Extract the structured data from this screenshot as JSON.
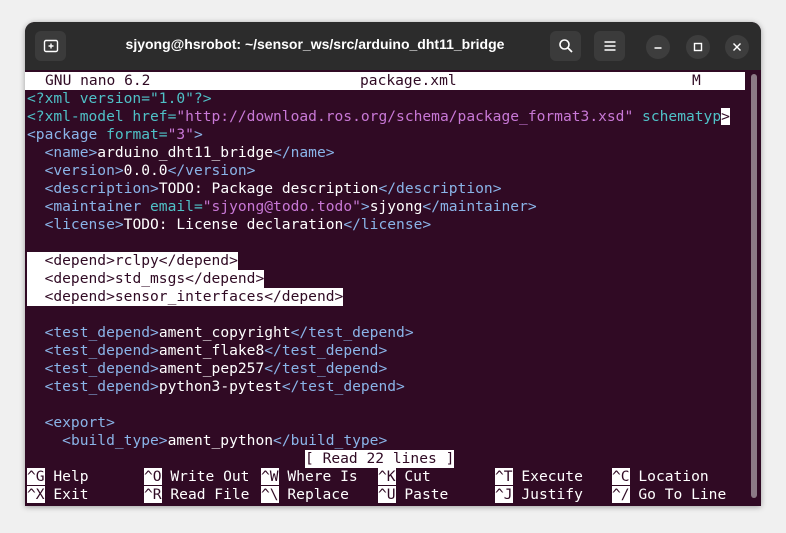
{
  "window": {
    "title": "sjyong@hsrobot: ~/sensor_ws/src/arduino_dht11_bridge"
  },
  "icons": {
    "new_tab": "new-tab-icon",
    "search": "search-icon",
    "menu": "hamburger-menu-icon",
    "minimize": "minimize-icon",
    "maximize": "maximize-icon",
    "close": "close-icon"
  },
  "nano": {
    "version": "GNU nano 6.2",
    "filename": "package.xml",
    "modified": "M",
    "status": "[ Read 22 lines ]"
  },
  "code": {
    "l1_pi": "<?xml version=\"1.0\"?>",
    "l2_pi": "<?xml-model href=",
    "l2_str": "\"http://download.ros.org/schema/package_format3.xsd\"",
    "l2_attr": " schematyp",
    "l2_cursor": ">",
    "l3_tag": "<package",
    "l3_attr": " format=",
    "l3_str": "\"3\"",
    "l3_end": ">",
    "l4_open": "<name>",
    "l4_text": "arduino_dht11_bridge",
    "l4_close": "</name>",
    "l5_open": "<version>",
    "l5_text": "0.0.0",
    "l5_close": "</version>",
    "l6_open": "<description>",
    "l6_text": "TODO: Package description",
    "l6_close": "</description>",
    "l7_open": "<maintainer",
    "l7_attr": " email=",
    "l7_str": "\"sjyong@todo.todo\"",
    "l7_gt": ">",
    "l7_text": "sjyong",
    "l7_close": "</maintainer>",
    "l8_open": "<license>",
    "l8_text": "TODO: License declaration",
    "l8_close": "</license>",
    "l10": "<depend>rclpy</depend>",
    "l11": "<depend>std_msgs</depend>",
    "l12": "<depend>sensor_interfaces</depend>",
    "l14_open": "<test_depend>",
    "l14_text": "ament_copyright",
    "l14_close": "</test_depend>",
    "l15_open": "<test_depend>",
    "l15_text": "ament_flake8",
    "l15_close": "</test_depend>",
    "l16_open": "<test_depend>",
    "l16_text": "ament_pep257",
    "l16_close": "</test_depend>",
    "l17_open": "<test_depend>",
    "l17_text": "python3-pytest",
    "l17_close": "</test_depend>",
    "l19": "<export>",
    "l20_open": "<build_type>",
    "l20_text": "ament_python",
    "l20_close": "</build_type>"
  },
  "shortcuts": [
    {
      "key": "^G",
      "label": "Help"
    },
    {
      "key": "^O",
      "label": "Write Out"
    },
    {
      "key": "^W",
      "label": "Where Is"
    },
    {
      "key": "^K",
      "label": "Cut"
    },
    {
      "key": "^T",
      "label": "Execute"
    },
    {
      "key": "^C",
      "label": "Location"
    },
    {
      "key": "^X",
      "label": "Exit"
    },
    {
      "key": "^R",
      "label": "Read File"
    },
    {
      "key": "^\\",
      "label": "Replace"
    },
    {
      "key": "^U",
      "label": "Paste"
    },
    {
      "key": "^J",
      "label": "Justify"
    },
    {
      "key": "^/",
      "label": "Go To Line"
    }
  ],
  "colors": {
    "terminal_bg": "#300a24",
    "titlebar_bg": "#2c2c2c",
    "tag": "#8ab4e8",
    "attribute": "#4fc1c7",
    "string": "#c878d6"
  }
}
